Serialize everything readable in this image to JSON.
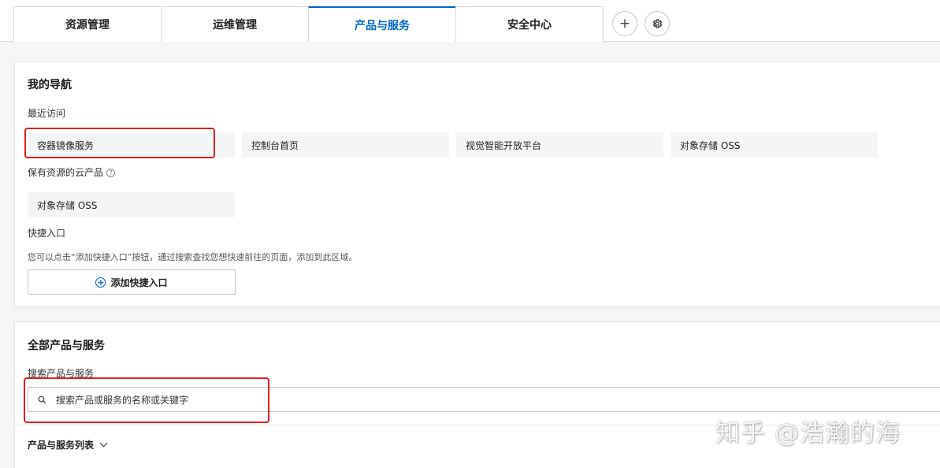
{
  "tabs": [
    {
      "label": "资源管理",
      "active": false
    },
    {
      "label": "运维管理",
      "active": false
    },
    {
      "label": "产品与服务",
      "active": true
    },
    {
      "label": "安全中心",
      "active": false
    }
  ],
  "tab_actions": {
    "add_symbol": "+",
    "settings_symbol": "⚙"
  },
  "my_nav": {
    "title": "我的导航",
    "recent_title": "最近访问",
    "recent_items": [
      "容器镜像服务",
      "控制台首页",
      "视觉智能开放平台",
      "对象存储 OSS"
    ],
    "resource_title": "保有资源的云产品",
    "resource_help_symbol": "?",
    "resource_items": [
      "对象存储 OSS"
    ],
    "shortcut_title": "快捷入口",
    "shortcut_hint": "您可以点击“添加快捷入口”按钮，通过搜索查找您想快速前往的页面，添加到此区域。",
    "add_shortcut_label": "添加快捷入口"
  },
  "all_products": {
    "title": "全部产品与服务",
    "search_label": "搜索产品与服务",
    "search_placeholder": "搜索产品或服务的名称或关键字",
    "list_toggle_label": "产品与服务列表"
  },
  "watermark": "知乎 @浩瀚的海",
  "colors": {
    "accent": "#0064c8",
    "highlight_box": "#e02020"
  }
}
